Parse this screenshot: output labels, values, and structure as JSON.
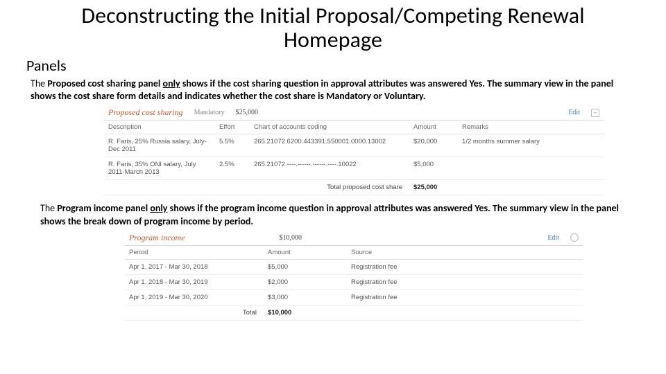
{
  "title_line1": "Deconstructing the Initial Proposal/Competing Renewal",
  "title_line2": "Homepage",
  "subhead": "Panels",
  "para1_pre": "The ",
  "para1_bold": "Proposed cost sharing panel ",
  "para1_only": "only",
  "para1_rest": " shows if the cost sharing question in approval attributes was answered Yes. The summary view in the panel shows the cost share form details and indicates whether the cost share is Mandatory or Voluntary.",
  "cost_panel": {
    "title": "Proposed cost sharing",
    "badge": "Mandatory",
    "amount": "$25,000",
    "edit": "Edit",
    "collapse": "–",
    "headers": [
      "Description",
      "Effort",
      "Chart of accounts coding",
      "Amount",
      "Remarks"
    ],
    "rows": [
      {
        "desc": "R. Faris, 25% Russia salary, July-Dec 2011",
        "effort": "5.5%",
        "coding": "265.21072.6200.443391.550001.0000.13002",
        "amount": "$20,000",
        "remarks": "1/2 months summer salary"
      },
      {
        "desc": "R. Faris, 35% ONI salary, July 2011-March 2013",
        "effort": "2.5%",
        "coding": "265.21072.----.------.------.----.10022",
        "amount": "$5,000",
        "remarks": ""
      }
    ],
    "total_label": "Total proposed cost share",
    "total_value": "$25,000"
  },
  "para2_pre": "The ",
  "para2_bold": "Program income panel ",
  "para2_only": "only",
  "para2_rest": " shows if the program income question in approval attributes was answered Yes. The summary view in the panel shows the break down of program income by period.",
  "income_panel": {
    "title": "Program income",
    "amount": "$10,000",
    "edit": "Edit",
    "headers": [
      "Period",
      "Amount",
      "Source"
    ],
    "rows": [
      {
        "period": "Apr 1, 2017 - Mar 30, 2018",
        "amount": "$5,000",
        "source": "Registration fee"
      },
      {
        "period": "Apr 1, 2018 - Mar 30, 2019",
        "amount": "$2,000",
        "source": "Registration fee"
      },
      {
        "period": "Apr 1, 2019 - Mar 30, 2020",
        "amount": "$3,000",
        "source": "Registration fee"
      }
    ],
    "total_label": "Total",
    "total_value": "$10,000"
  }
}
